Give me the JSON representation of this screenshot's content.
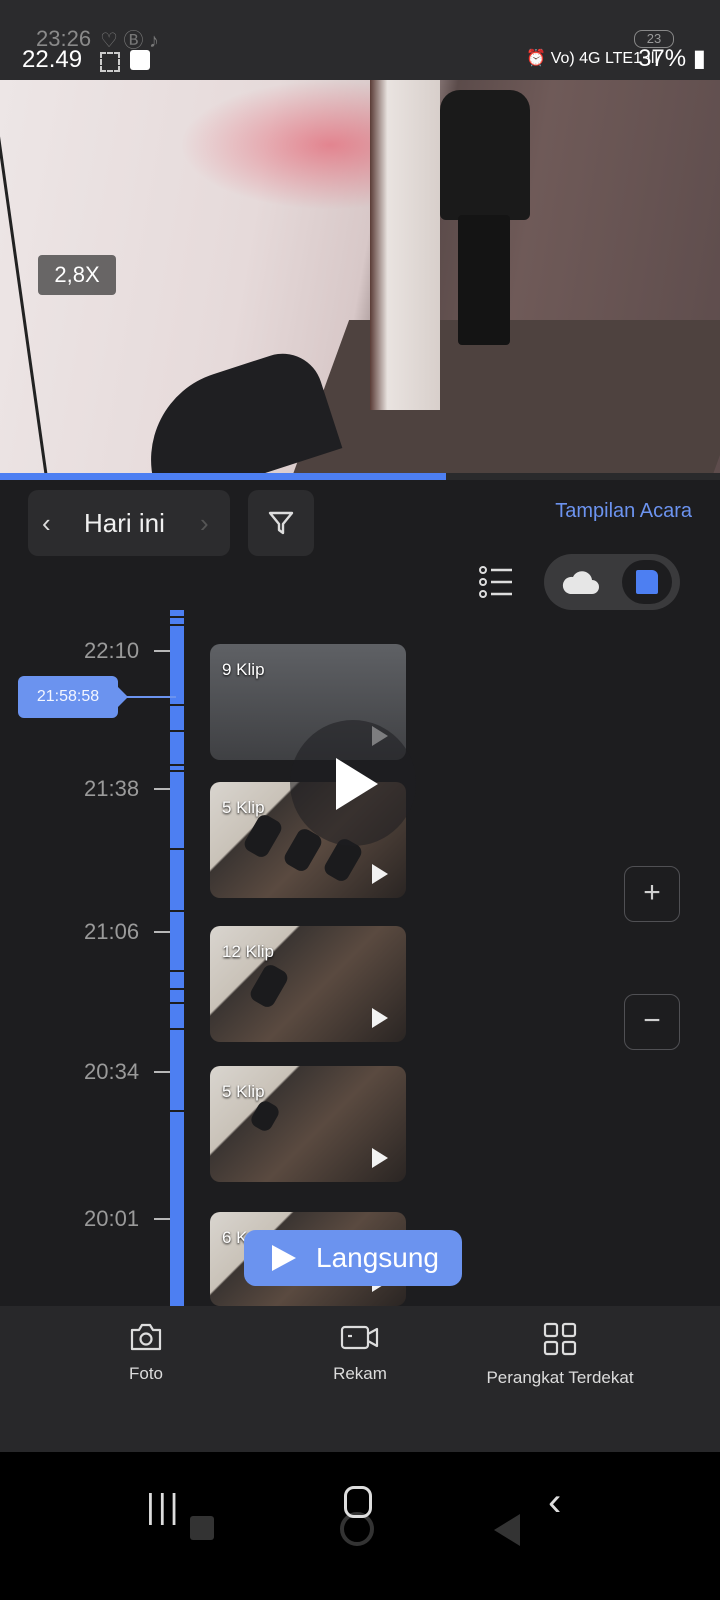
{
  "status_bar": {
    "ghost_time": "23:26",
    "time": "22.49",
    "battery": "37%",
    "notification_count": "23",
    "network": "Vo) 4G LTE1"
  },
  "video": {
    "zoom_label": "2,8X",
    "progress_fraction": 0.62
  },
  "controls": {
    "date_label": "Hari ini",
    "event_view_label": "Tampilan Acara",
    "storage_selected": "sd-card"
  },
  "timeline": {
    "ticks": [
      "22:10",
      "21:38",
      "21:06",
      "20:34",
      "20:01"
    ],
    "cursor_time": "21:58:58"
  },
  "clips": [
    {
      "count_label": "9 Klip"
    },
    {
      "count_label": "5 Klip"
    },
    {
      "count_label": "12 Klip"
    },
    {
      "count_label": "5 Klip"
    },
    {
      "count_label": "6 K"
    }
  ],
  "live_button": {
    "label": "Langsung"
  },
  "actions": {
    "photo": "Foto",
    "record": "Rekam",
    "nearby": "Perangkat Terdekat"
  },
  "colors": {
    "accent": "#4d7ff2",
    "panel_bg": "#1d1d1f",
    "action_bar_bg": "#28282a"
  }
}
